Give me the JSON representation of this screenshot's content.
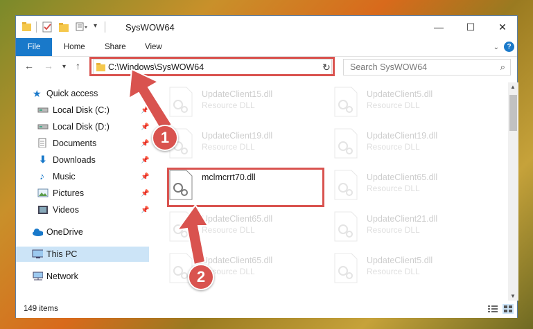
{
  "window": {
    "title": "SysWOW64"
  },
  "ribbon": {
    "file": "File",
    "home": "Home",
    "share": "Share",
    "view": "View",
    "help": "?"
  },
  "controls": {
    "minimize": "—",
    "maximize": "☐",
    "close": "✕"
  },
  "address": {
    "path": "C:\\Windows\\SysWOW64"
  },
  "search": {
    "placeholder": "Search SysWOW64"
  },
  "sidebar": {
    "items": [
      {
        "label": "Quick access",
        "icon": "star-icon"
      },
      {
        "label": "Local Disk (C:)",
        "icon": "drive-icon",
        "pinned": true
      },
      {
        "label": "Local Disk (D:)",
        "icon": "drive-icon",
        "pinned": true
      },
      {
        "label": "Documents",
        "icon": "documents-icon",
        "pinned": true
      },
      {
        "label": "Downloads",
        "icon": "downloads-icon",
        "pinned": true
      },
      {
        "label": "Music",
        "icon": "music-icon",
        "pinned": true
      },
      {
        "label": "Pictures",
        "icon": "pictures-icon",
        "pinned": true
      },
      {
        "label": "Videos",
        "icon": "videos-icon",
        "pinned": true
      },
      {
        "label": "OneDrive",
        "icon": "cloud-icon"
      },
      {
        "label": "This PC",
        "icon": "computer-icon",
        "selected": true
      },
      {
        "label": "Network",
        "icon": "network-icon"
      }
    ]
  },
  "files": [
    {
      "name": "UpdateClient15.dll",
      "type": "Resource DLL"
    },
    {
      "name": "UpdateClient5.dll",
      "type": "Resource DLL"
    },
    {
      "name": "UpdateClient19.dll",
      "type": "Resource DLL"
    },
    {
      "name": "UpdateClient19.dll",
      "type": "Resource DLL"
    },
    {
      "name": "mclmcrrt70.dll",
      "type": ""
    },
    {
      "name": "UpdateClient65.dll",
      "type": "Resource DLL"
    },
    {
      "name": "UpdateClient65.dll",
      "type": "Resource DLL"
    },
    {
      "name": "UpdateClient21.dll",
      "type": "Resource DLL"
    },
    {
      "name": "UpdateClient65.dll",
      "type": "Resource DLL"
    },
    {
      "name": "UpdateClient5.dll",
      "type": "Resource DLL"
    }
  ],
  "status": {
    "count": "149 items"
  },
  "callouts": {
    "one": "1",
    "two": "2"
  },
  "colors": {
    "accent": "#1979ca",
    "highlight": "#d9534f",
    "selected": "#cce4f7"
  }
}
